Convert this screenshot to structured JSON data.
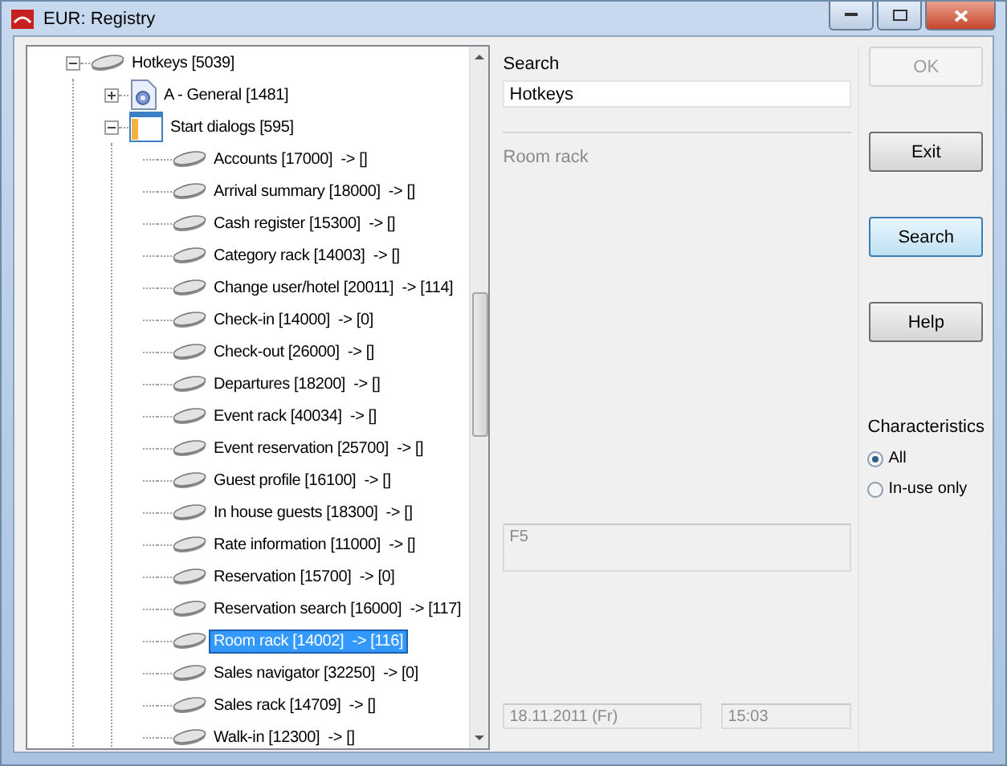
{
  "window": {
    "title": "EUR: Registry"
  },
  "tree": [
    {
      "label": "Hotkeys [5039]",
      "kind": "disc",
      "expanded": true,
      "selected": false,
      "children": [
        {
          "label": "A - General [1481]",
          "kind": "document",
          "expanded": false,
          "selected": false
        },
        {
          "label": "Start dialogs [595]",
          "kind": "window",
          "expanded": true,
          "selected": false,
          "children": [
            {
              "label": "Accounts [17000]  -> []",
              "kind": "disc",
              "selected": false
            },
            {
              "label": "Arrival summary [18000]  -> []",
              "kind": "disc",
              "selected": false
            },
            {
              "label": "Cash register [15300]  -> []",
              "kind": "disc",
              "selected": false
            },
            {
              "label": "Category rack [14003]  -> []",
              "kind": "disc",
              "selected": false
            },
            {
              "label": "Change user/hotel [20011]  -> [114]",
              "kind": "disc",
              "selected": false
            },
            {
              "label": "Check-in [14000]  -> [0]",
              "kind": "disc",
              "selected": false
            },
            {
              "label": "Check-out [26000]  -> []",
              "kind": "disc",
              "selected": false
            },
            {
              "label": "Departures [18200]  -> []",
              "kind": "disc",
              "selected": false
            },
            {
              "label": "Event rack [40034]  -> []",
              "kind": "disc",
              "selected": false
            },
            {
              "label": "Event reservation [25700]  -> []",
              "kind": "disc",
              "selected": false
            },
            {
              "label": "Guest profile [16100]  -> []",
              "kind": "disc",
              "selected": false
            },
            {
              "label": "In house guests [18300]  -> []",
              "kind": "disc",
              "selected": false
            },
            {
              "label": "Rate information [11000]  -> []",
              "kind": "disc",
              "selected": false
            },
            {
              "label": "Reservation [15700]  -> [0]",
              "kind": "disc",
              "selected": false
            },
            {
              "label": "Reservation search [16000]  -> [117]",
              "kind": "disc",
              "selected": false
            },
            {
              "label": "Room rack [14002]  -> [116]",
              "kind": "disc",
              "selected": true
            },
            {
              "label": "Sales navigator [32250]  -> [0]",
              "kind": "disc",
              "selected": false
            },
            {
              "label": "Sales rack [14709]  -> []",
              "kind": "disc",
              "selected": false
            },
            {
              "label": "Walk-in [12300]  -> []",
              "kind": "disc",
              "selected": false
            }
          ]
        }
      ]
    }
  ],
  "search": {
    "label": "Search",
    "value": "Hotkeys"
  },
  "description": "Room rack",
  "hotkey": "F5",
  "date": "18.11.2011 (Fr)",
  "time": "15:03",
  "buttons": [
    {
      "label": "OK",
      "disabled": true,
      "focused": false
    },
    {
      "label": "Exit",
      "disabled": false,
      "focused": false
    },
    {
      "label": "Search",
      "disabled": false,
      "focused": true
    },
    {
      "label": "Help",
      "disabled": false,
      "focused": false
    }
  ],
  "characteristics": {
    "title": "Characteristics",
    "options": [
      {
        "label": "All",
        "selected": true
      },
      {
        "label": "In-use only",
        "selected": false
      }
    ]
  }
}
